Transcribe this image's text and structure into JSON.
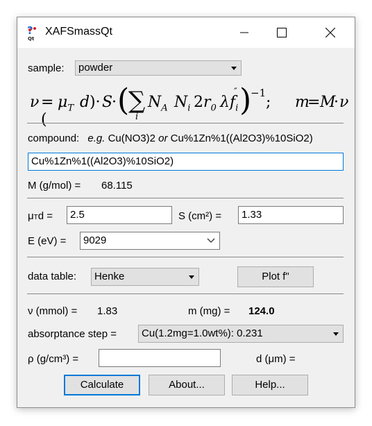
{
  "window": {
    "title": "XAFSmassQt"
  },
  "sample": {
    "label": "sample:",
    "value": "powder"
  },
  "compound": {
    "label": "compound:",
    "hint_eg": "e.g.",
    "hint_ex1": "Cu(NO3)2",
    "hint_or": "or",
    "hint_ex2": "Cu%1Zn%1((Al2O3)%10SiO2)",
    "value": "Cu%1Zn%1((Al2O3)%10SiO2)"
  },
  "molar_mass": {
    "label": "M (g/mol) =",
    "value": "68.115"
  },
  "mu_t_d": {
    "label": "μTd =",
    "value": "2.5"
  },
  "area": {
    "label": "S (cm²) =",
    "value": "1.33"
  },
  "energy": {
    "label": "E (eV) =",
    "value": "9029"
  },
  "data_table": {
    "label": "data table:",
    "value": "Henke",
    "plot_button": "Plot f\""
  },
  "results": {
    "nu_label": "ν (mmol) =",
    "nu_value": "1.83",
    "m_label": "m (mg) =",
    "m_value": "124.0",
    "step_label": "absorptance step =",
    "step_value": "Cu(1.2mg=1.0wt%): 0.231",
    "rho_label": "ρ (g/cm³) =",
    "rho_value": "",
    "d_label": "d (μm) ="
  },
  "buttons": {
    "calculate": "Calculate",
    "about": "About...",
    "help": "Help..."
  }
}
